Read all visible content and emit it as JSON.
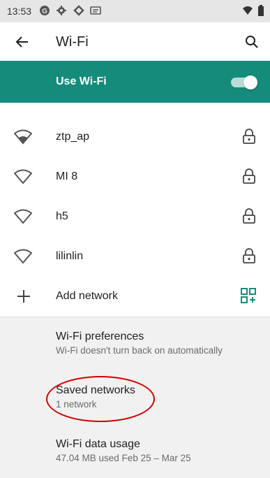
{
  "status_bar": {
    "time": "13:53",
    "icons": [
      "g-icon",
      "gear-icon",
      "sync-icon",
      "message-icon"
    ],
    "right_icons": [
      "wifi-icon",
      "battery-icon"
    ]
  },
  "appbar": {
    "title": "Wi-Fi"
  },
  "wifi_toggle": {
    "label": "Use Wi-Fi",
    "state": "on",
    "color": "#158b7b"
  },
  "networks": [
    {
      "name": "ztp_ap",
      "locked": true,
      "connected_strength": "full"
    },
    {
      "name": "MI 8",
      "locked": true
    },
    {
      "name": "h5",
      "locked": true
    },
    {
      "name": "lilinlin",
      "locked": true
    }
  ],
  "add_network": {
    "label": "Add network"
  },
  "preferences": {
    "wifi_preferences": {
      "title": "Wi-Fi preferences",
      "subtitle": "Wi-Fi doesn't turn back on automatically"
    },
    "saved_networks": {
      "title": "Saved networks",
      "subtitle": "1 network"
    },
    "data_usage": {
      "title": "Wi-Fi data usage",
      "subtitle": "47.04 MB used Feb 25 – Mar 25"
    }
  },
  "annotation_color": "#d30000"
}
